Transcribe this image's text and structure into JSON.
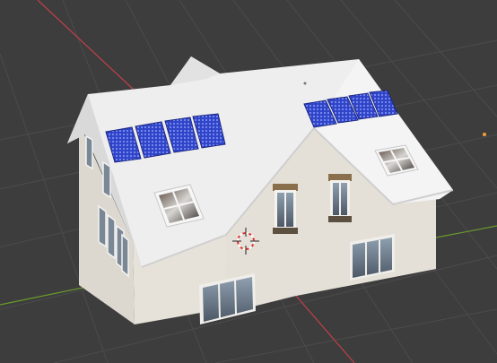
{
  "viewport": {
    "app": "3D viewport",
    "background_color": "#3d3d3d",
    "grid_color": "#4b4b4b",
    "x_axis_color": "#c0404a",
    "y_axis_color": "#6a9a2c"
  },
  "model": {
    "name": "house",
    "wall_color": "#e9e6df",
    "roof_color": "#f1f1f1",
    "solar_panel_color": "#2d3fbf",
    "window_glass_color": "#6e7c8a",
    "window_frame_color": "#f5f5f5",
    "solar_panel_groups": 2,
    "panels_per_group": 4
  },
  "overlays": {
    "cursor_icon": "3d-cursor-icon",
    "light_icon": "light-object-icon"
  }
}
